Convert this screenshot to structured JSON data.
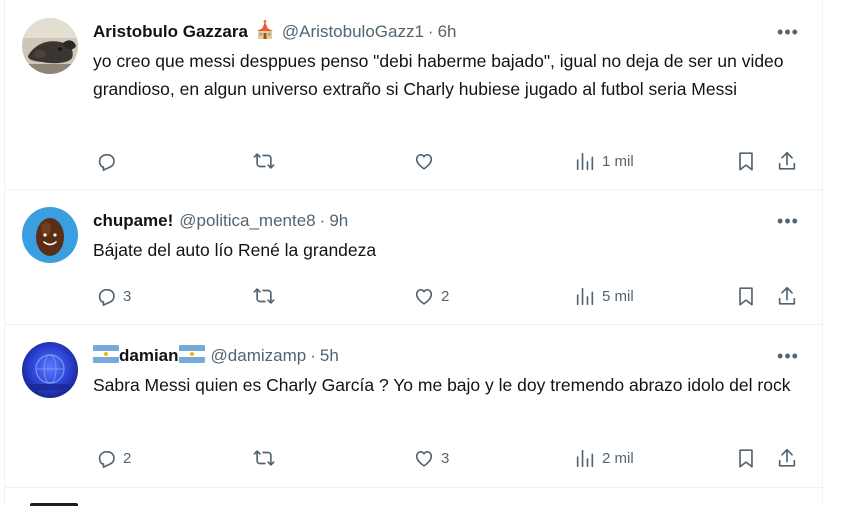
{
  "tweets": [
    {
      "name": "Aristobulo Gazzara",
      "handle": "@AristobuloGazz1",
      "time": "6h",
      "text": "yo creo que messi desppues penso \"debi haberme bajado\", igual no deja de ser un video grandioso, en algun universo extraño si Charly hubiese jugado al futbol seria Messi",
      "replies": "",
      "reposts": "",
      "likes": "",
      "views": "1 mil",
      "badge": "church-emoji"
    },
    {
      "name": "chupame!",
      "handle": "@politica_mente8",
      "time": "9h",
      "text": "Bájate del auto lío René la grandeza",
      "replies": "3",
      "reposts": "",
      "likes": "2",
      "views": "5 mil"
    },
    {
      "name": "damian",
      "handle": "@damizamp",
      "time": "5h",
      "text": "Sabra Messi quien es Charly García ? Yo me bajo y le doy tremendo abrazo idolo del rock",
      "replies": "2",
      "reposts": "",
      "likes": "3",
      "views": "2 mil",
      "badge": "argentina-flag-emoji"
    }
  ],
  "more_label": "•••",
  "dot_separator": "·",
  "colors": {
    "text": "#0f1419",
    "secondary": "#536471",
    "divider": "#eff3f4",
    "avatar2_bg": "#3b9ee0"
  }
}
